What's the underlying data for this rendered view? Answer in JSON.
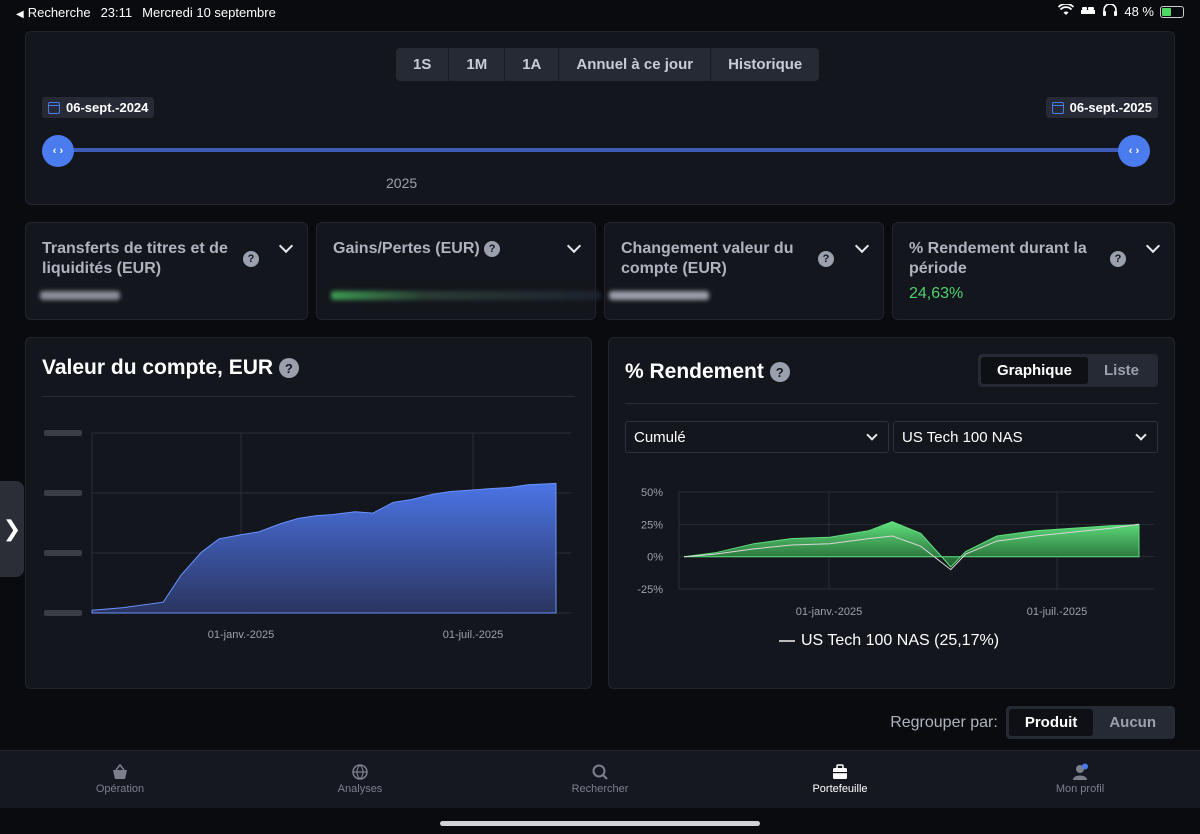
{
  "statusbar": {
    "back": "Recherche",
    "time": "23:11",
    "date": "Mercredi 10 septembre",
    "battery": "48 %",
    "battery_level": 0.48
  },
  "range": {
    "periods": [
      "1S",
      "1M",
      "1A",
      "Annuel à ce jour",
      "Historique"
    ],
    "start_date": "06-sept.-2024",
    "end_date": "06-sept.-2025",
    "year_label": "2025",
    "handle_glyph": "‹ ›"
  },
  "stats": [
    {
      "title": "Transferts de titres et de liquidités (EUR)",
      "value": ""
    },
    {
      "title": "Gains/Pertes (EUR)",
      "value": ""
    },
    {
      "title": "Changement valeur du compte (EUR)",
      "value": ""
    },
    {
      "title": "% Rendement durant la période",
      "value": "24,63%"
    }
  ],
  "account": {
    "title": "Valeur du compte, EUR",
    "x_ticks": [
      "01-janv.-2025",
      "01-juil.-2025"
    ]
  },
  "returns": {
    "title": "% Rendement",
    "view_options": [
      "Graphique",
      "Liste"
    ],
    "active_view": "Graphique",
    "mode": "Cumulé",
    "benchmark": "US Tech 100 NAS",
    "legend": "US Tech 100 NAS (25,17%)"
  },
  "group": {
    "label": "Regrouper par:",
    "options": [
      "Produit",
      "Aucun"
    ],
    "active": "Produit"
  },
  "tabs": [
    {
      "label": "Opération",
      "icon": "basket-icon"
    },
    {
      "label": "Analyses",
      "icon": "globe-star-icon"
    },
    {
      "label": "Rechercher",
      "icon": "search-icon"
    },
    {
      "label": "Portefeuille",
      "icon": "briefcase-icon"
    },
    {
      "label": "Mon profil",
      "icon": "profile-icon"
    }
  ],
  "colors": {
    "accent": "#4a7cf0",
    "positive": "#4fcf6e",
    "background": "#0a0b0f",
    "panel": "#14161d"
  },
  "chart_data": [
    {
      "type": "area",
      "title": "Valeur du compte, EUR",
      "x_tick_labels": [
        "01-janv.-2025",
        "01-juil.-2025"
      ],
      "y_tick_labels_visible": false,
      "x": [
        "2024-09-06",
        "2024-10-01",
        "2024-11-01",
        "2024-11-15",
        "2024-12-01",
        "2024-12-15",
        "2025-01-01",
        "2025-01-15",
        "2025-02-01",
        "2025-02-15",
        "2025-03-01",
        "2025-03-15",
        "2025-04-01",
        "2025-04-15",
        "2025-05-01",
        "2025-05-15",
        "2025-06-01",
        "2025-06-15",
        "2025-07-01",
        "2025-07-15",
        "2025-08-01",
        "2025-08-15",
        "2025-09-06"
      ],
      "y_relative": [
        0.02,
        0.04,
        0.08,
        0.28,
        0.45,
        0.55,
        0.58,
        0.6,
        0.66,
        0.7,
        0.72,
        0.73,
        0.75,
        0.74,
        0.82,
        0.84,
        0.88,
        0.9,
        0.91,
        0.92,
        0.93,
        0.95,
        0.96
      ],
      "grid": true
    },
    {
      "type": "line",
      "title": "% Rendement",
      "ylim": [
        -25,
        50
      ],
      "y_ticks": [
        "50%",
        "25%",
        "0%",
        "-25%"
      ],
      "x_tick_labels": [
        "01-janv.-2025",
        "01-juil.-2025"
      ],
      "x": [
        "2024-09-06",
        "2024-10-01",
        "2024-11-01",
        "2024-12-01",
        "2025-01-01",
        "2025-02-01",
        "2025-02-20",
        "2025-03-15",
        "2025-04-08",
        "2025-04-20",
        "2025-05-15",
        "2025-06-15",
        "2025-07-15",
        "2025-08-15",
        "2025-09-06"
      ],
      "series": [
        {
          "values": [
            0,
            3,
            10,
            14,
            15,
            20,
            27,
            18,
            -8,
            4,
            16,
            20,
            22,
            24,
            24.6
          ]
        },
        {
          "name": "US Tech 100 NAS",
          "values": [
            0,
            2,
            6,
            9,
            10,
            14,
            16,
            8,
            -10,
            2,
            12,
            16,
            19,
            22,
            25.2
          ]
        }
      ],
      "grid": true
    }
  ]
}
